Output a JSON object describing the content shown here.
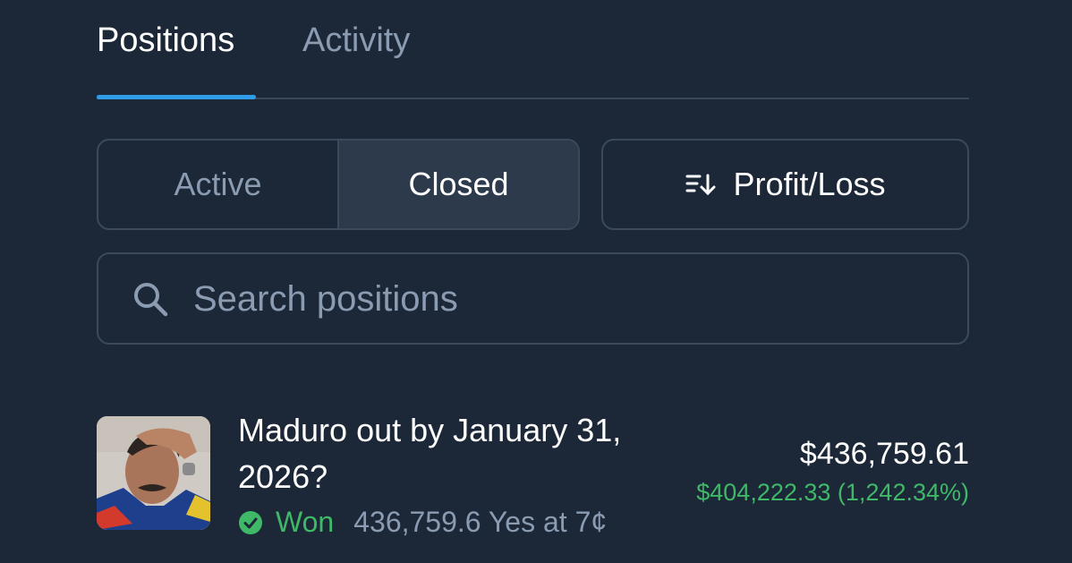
{
  "tabs": {
    "positions": "Positions",
    "activity": "Activity"
  },
  "filter": {
    "active": "Active",
    "closed": "Closed",
    "selected": "Closed"
  },
  "sort": {
    "label": "Profit/Loss",
    "icon": "sort-descending-icon"
  },
  "search": {
    "placeholder": "Search positions",
    "value": "",
    "icon": "search-icon"
  },
  "positions": [
    {
      "title": "Maduro out by January 31, 2026?",
      "status": "Won",
      "status_icon": "check-circle-icon",
      "shares_text": "436,759.6 Yes at 7¢",
      "value": "$436,759.61",
      "pnl": "$404,222.33 (1,242.34%)"
    }
  ],
  "colors": {
    "background": "#1c2838",
    "accent": "#2f9ce8",
    "positive": "#3fb868",
    "muted": "#8a9bb2",
    "border": "#3a4a5c"
  }
}
